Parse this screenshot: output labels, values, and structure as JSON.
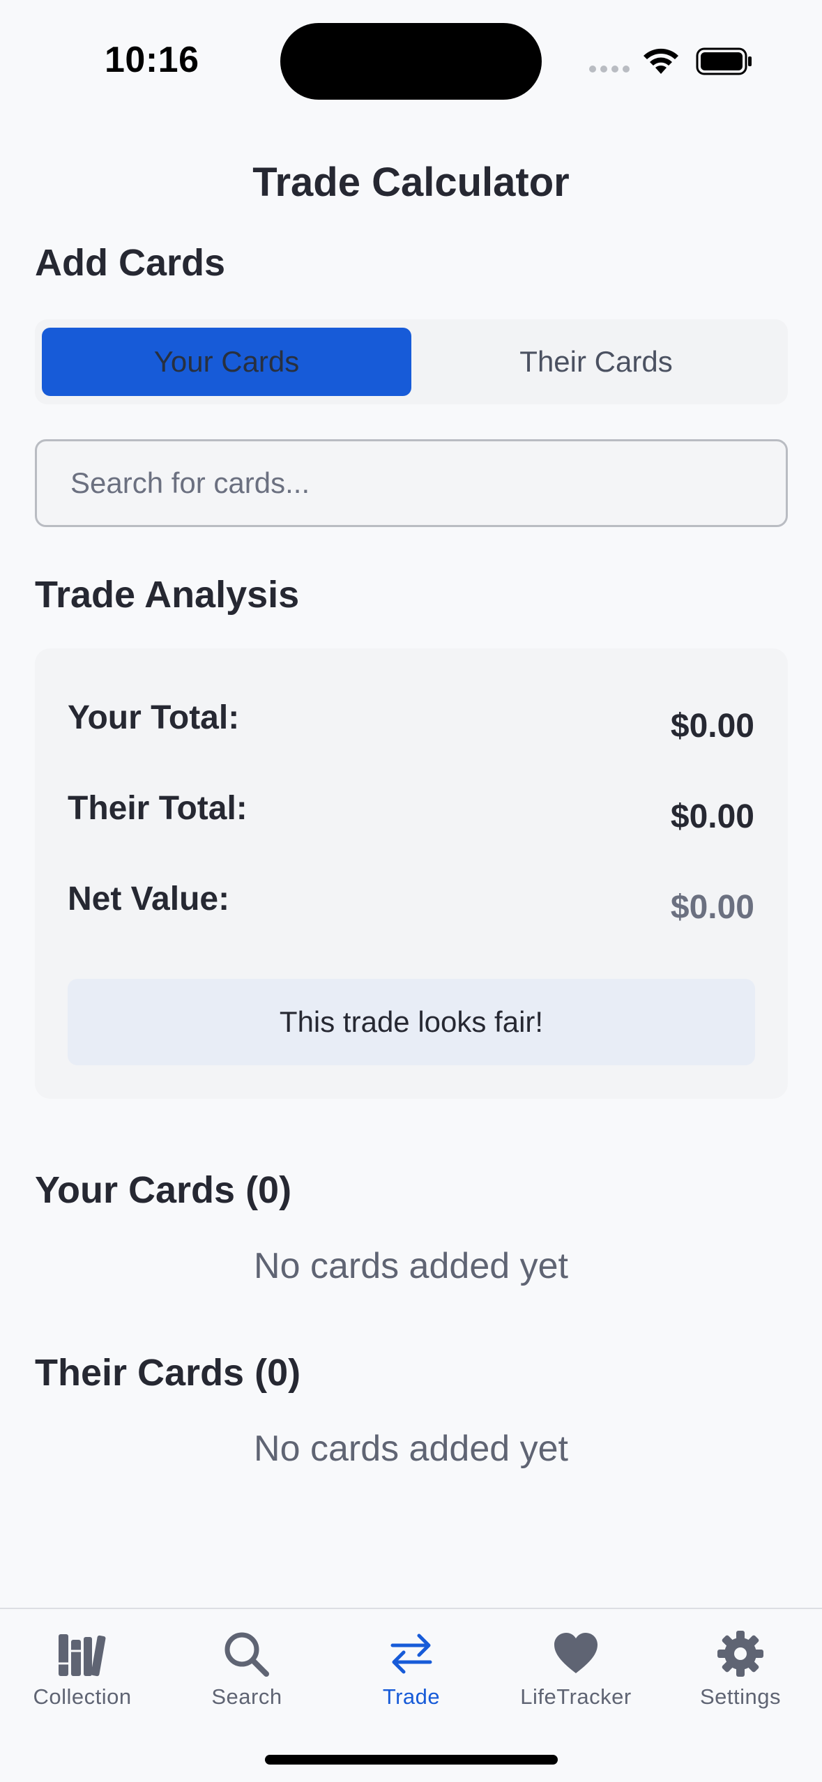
{
  "status": {
    "time": "10:16"
  },
  "header": {
    "title": "Trade Calculator"
  },
  "add_cards": {
    "title": "Add Cards",
    "tabs": [
      {
        "label": "Your Cards",
        "active": true
      },
      {
        "label": "Their Cards",
        "active": false
      }
    ],
    "search_placeholder": "Search for cards..."
  },
  "analysis": {
    "title": "Trade Analysis",
    "your_total_label": "Your Total:",
    "your_total_value": "$0.00",
    "their_total_label": "Their Total:",
    "their_total_value": "$0.00",
    "net_value_label": "Net Value:",
    "net_value_value": "$0.00",
    "verdict": "This trade looks fair!"
  },
  "your_cards": {
    "title": "Your Cards (0)",
    "empty": "No cards added yet"
  },
  "their_cards": {
    "title": "Their Cards (0)",
    "empty": "No cards added yet"
  },
  "tabbar": {
    "items": [
      {
        "label": "Collection",
        "icon": "books-icon"
      },
      {
        "label": "Search",
        "icon": "magnifier-icon"
      },
      {
        "label": "Trade",
        "icon": "swap-arrows-icon",
        "active": true
      },
      {
        "label": "LifeTracker",
        "icon": "heart-icon"
      },
      {
        "label": "Settings",
        "icon": "gear-icon"
      }
    ]
  },
  "colors": {
    "accent": "#175bd8",
    "text": "#262832",
    "muted": "#6b7080"
  }
}
